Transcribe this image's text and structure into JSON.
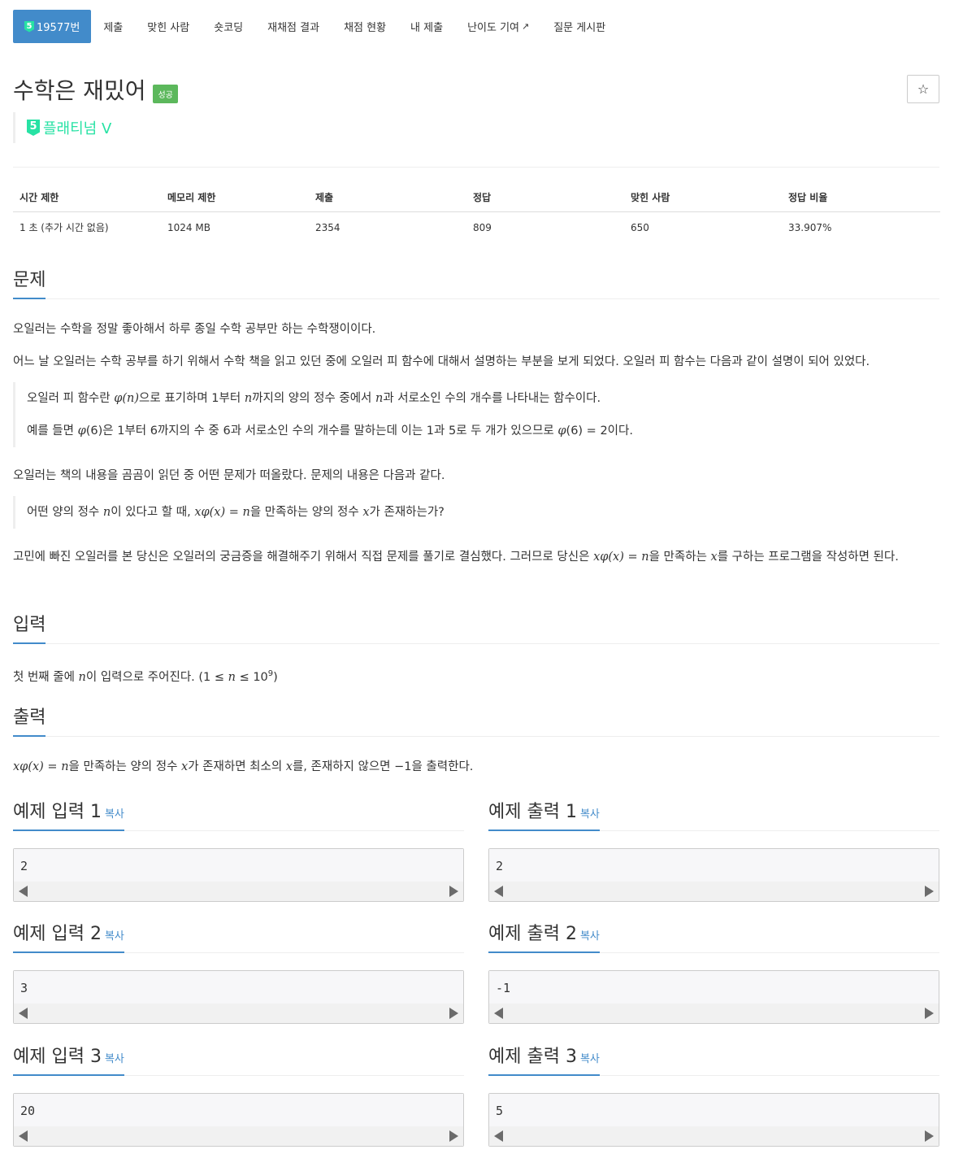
{
  "nav": {
    "problem_tier_num": "5",
    "problem_id": "19577번",
    "tabs": [
      "제출",
      "맞힌 사람",
      "숏코딩",
      "재채점 결과",
      "채점 현황",
      "내 제출",
      "난이도 기여",
      "질문 게시판"
    ]
  },
  "problem": {
    "title": "수학은 재밌어",
    "status_badge": "성공",
    "tier_num": "5",
    "tier": "플래티넘 V",
    "star": "☆"
  },
  "colors": {
    "accent": "#428bca",
    "tier": "#27e2a4",
    "success": "#5cb85c"
  },
  "stats": {
    "headers": [
      "시간 제한",
      "메모리 제한",
      "제출",
      "정답",
      "맞힌 사람",
      "정답 비율"
    ],
    "values": [
      "1 초 (추가 시간 없음)",
      "1024 MB",
      "2354",
      "809",
      "650",
      "33.907%"
    ]
  },
  "sections": {
    "problem_heading": "문제",
    "input_heading": "입력",
    "output_heading": "출력"
  },
  "description": {
    "p1": "오일러는 수학을 정말 좋아해서 하루 종일 수학 공부만 하는 수학쟁이이다.",
    "p2": "어느 날 오일러는 수학 공부를 하기 위해서 수학 책을 읽고 있던 중에 오일러 피 함수에 대해서 설명하는 부분을 보게 되었다. 오일러 피 함수는 다음과 같이 설명이 되어 있었다.",
    "q1a": "오일러 피 함수란 ",
    "q1_phi_n": "φ(n)",
    "q1b": "으로 표기하며 1부터 ",
    "q1_n": "n",
    "q1c": "까지의 양의 정수 중에서 ",
    "q1_n2": "n",
    "q1d": "과 서로소인 수의 개수를 나타내는 함수이다.",
    "q2a": "예를 들면 ",
    "q2_phi": "φ",
    "q2b": "(6)은 1부터 6까지의 수 중 6과 서로소인 수의 개수를 말하는데 이는 1과 5로 두 개가 있으므로 ",
    "q2_phi2": "φ",
    "q2c": "(6) = 2이다.",
    "p3": "오일러는 책의 내용을 곰곰이 읽던 중 어떤 문제가 떠올랐다. 문제의 내용은 다음과 같다.",
    "q3a": "어떤 양의 정수 ",
    "q3_n": "n",
    "q3b": "이 있다고 할 때, ",
    "q3_eq": "xφ(x) = n",
    "q3c": "을 만족하는 양의 정수 ",
    "q3_x": "x",
    "q3d": "가 존재하는가?",
    "p4a": "고민에 빠진 오일러를 본 당신은 오일러의 궁금증을 해결해주기 위해서 직접 문제를 풀기로 결심했다. 그러므로 당신은 ",
    "p4_eq": "xφ(x) = n",
    "p4b": "을 만족하는 ",
    "p4_x": "x",
    "p4c": "를 구하는 프로그램을 작성하면 된다."
  },
  "input_desc": {
    "a": "첫 번째 줄에 ",
    "n": "n",
    "b": "이 입력으로 주어진다. (1 ≤ ",
    "n2": "n",
    "c": " ≤ 10",
    "exp": "9",
    "d": ")"
  },
  "output_desc": {
    "eq": "xφ(x) = n",
    "a": "을 만족하는 양의 정수 ",
    "x": "x",
    "b": "가 존재하면 최소의 ",
    "x2": "x",
    "c": "를, 존재하지 않으면 −1을 출력한다."
  },
  "samples": {
    "copy_label": "복사",
    "items": [
      {
        "in_title": "예제 입력 1",
        "in_val": "2",
        "out_title": "예제 출력 1",
        "out_val": "2"
      },
      {
        "in_title": "예제 입력 2",
        "in_val": "3",
        "out_title": "예제 출력 2",
        "out_val": "-1"
      },
      {
        "in_title": "예제 입력 3",
        "in_val": "20",
        "out_title": "예제 출력 3",
        "out_val": "5"
      }
    ]
  }
}
